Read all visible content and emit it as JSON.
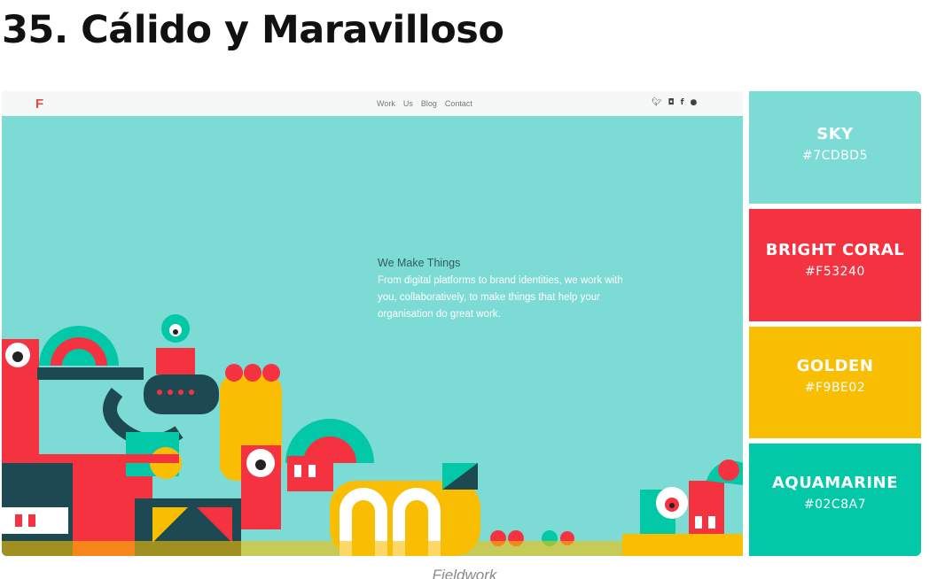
{
  "title": "35. Cálido y Maravilloso",
  "website": {
    "logo": "F",
    "nav": [
      "Work",
      "Us",
      "Blog",
      "Contact"
    ],
    "social_icons": [
      "twitter-icon",
      "instagram-icon",
      "facebook-icon",
      "github-icon"
    ],
    "hero_heading": "We Make Things",
    "hero_body": "From digital platforms to brand identities, we work with you, collaboratively, to make things that help your organisation do great work."
  },
  "palette": [
    {
      "name": "SKY",
      "hex": "#7CDBD5",
      "color": "#7CDBD5"
    },
    {
      "name": "BRIGHT CORAL",
      "hex": "#F53240",
      "color": "#F53240"
    },
    {
      "name": "GOLDEN",
      "hex": "#F9BE02",
      "color": "#F9BE02"
    },
    {
      "name": "AQUAMARINE",
      "hex": "#02C8A7",
      "color": "#02C8A7"
    }
  ],
  "caption": "Fieldwork"
}
